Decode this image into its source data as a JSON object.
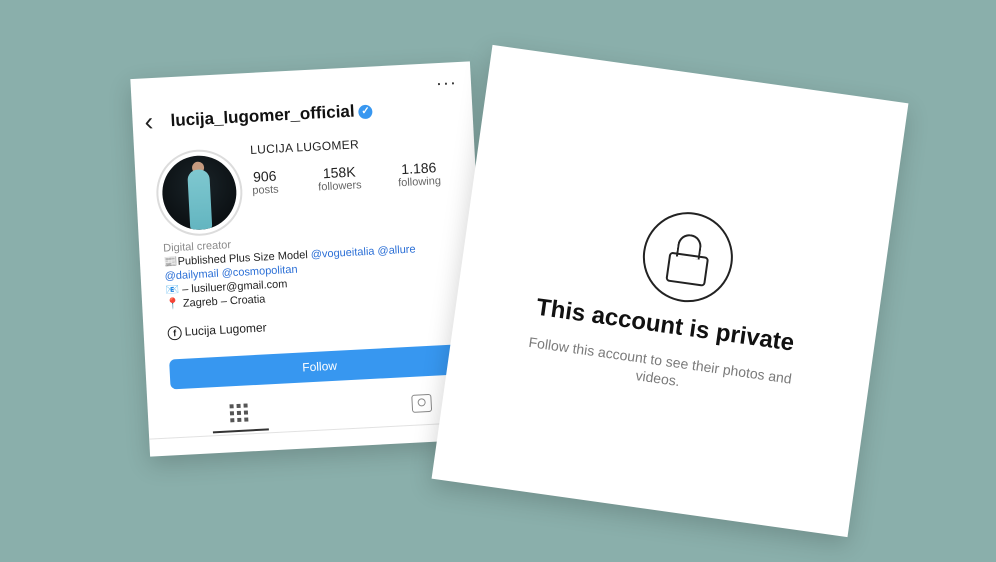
{
  "profile": {
    "username": "lucija_lugomer_official",
    "display_name": "LUCIJA LUGOMER",
    "stats": [
      {
        "value": "906",
        "label": "posts"
      },
      {
        "value": "158K",
        "label": "followers"
      },
      {
        "value": "1.186",
        "label": "following"
      }
    ],
    "bio": {
      "category": "Digital creator",
      "line1_text": "Published Plus Size Model ",
      "line1_links": "@vogueitalia @allure",
      "line2_links": "@dailymail @cosmopolitan",
      "line3": "– lusiluer@gmail.com",
      "line4": "Zagreb – Croatia"
    },
    "facebook_name": "Lucija Lugomer",
    "follow_label": "Follow"
  },
  "private": {
    "title": "This account is private",
    "subtitle": "Follow this account to see their photos and videos."
  }
}
